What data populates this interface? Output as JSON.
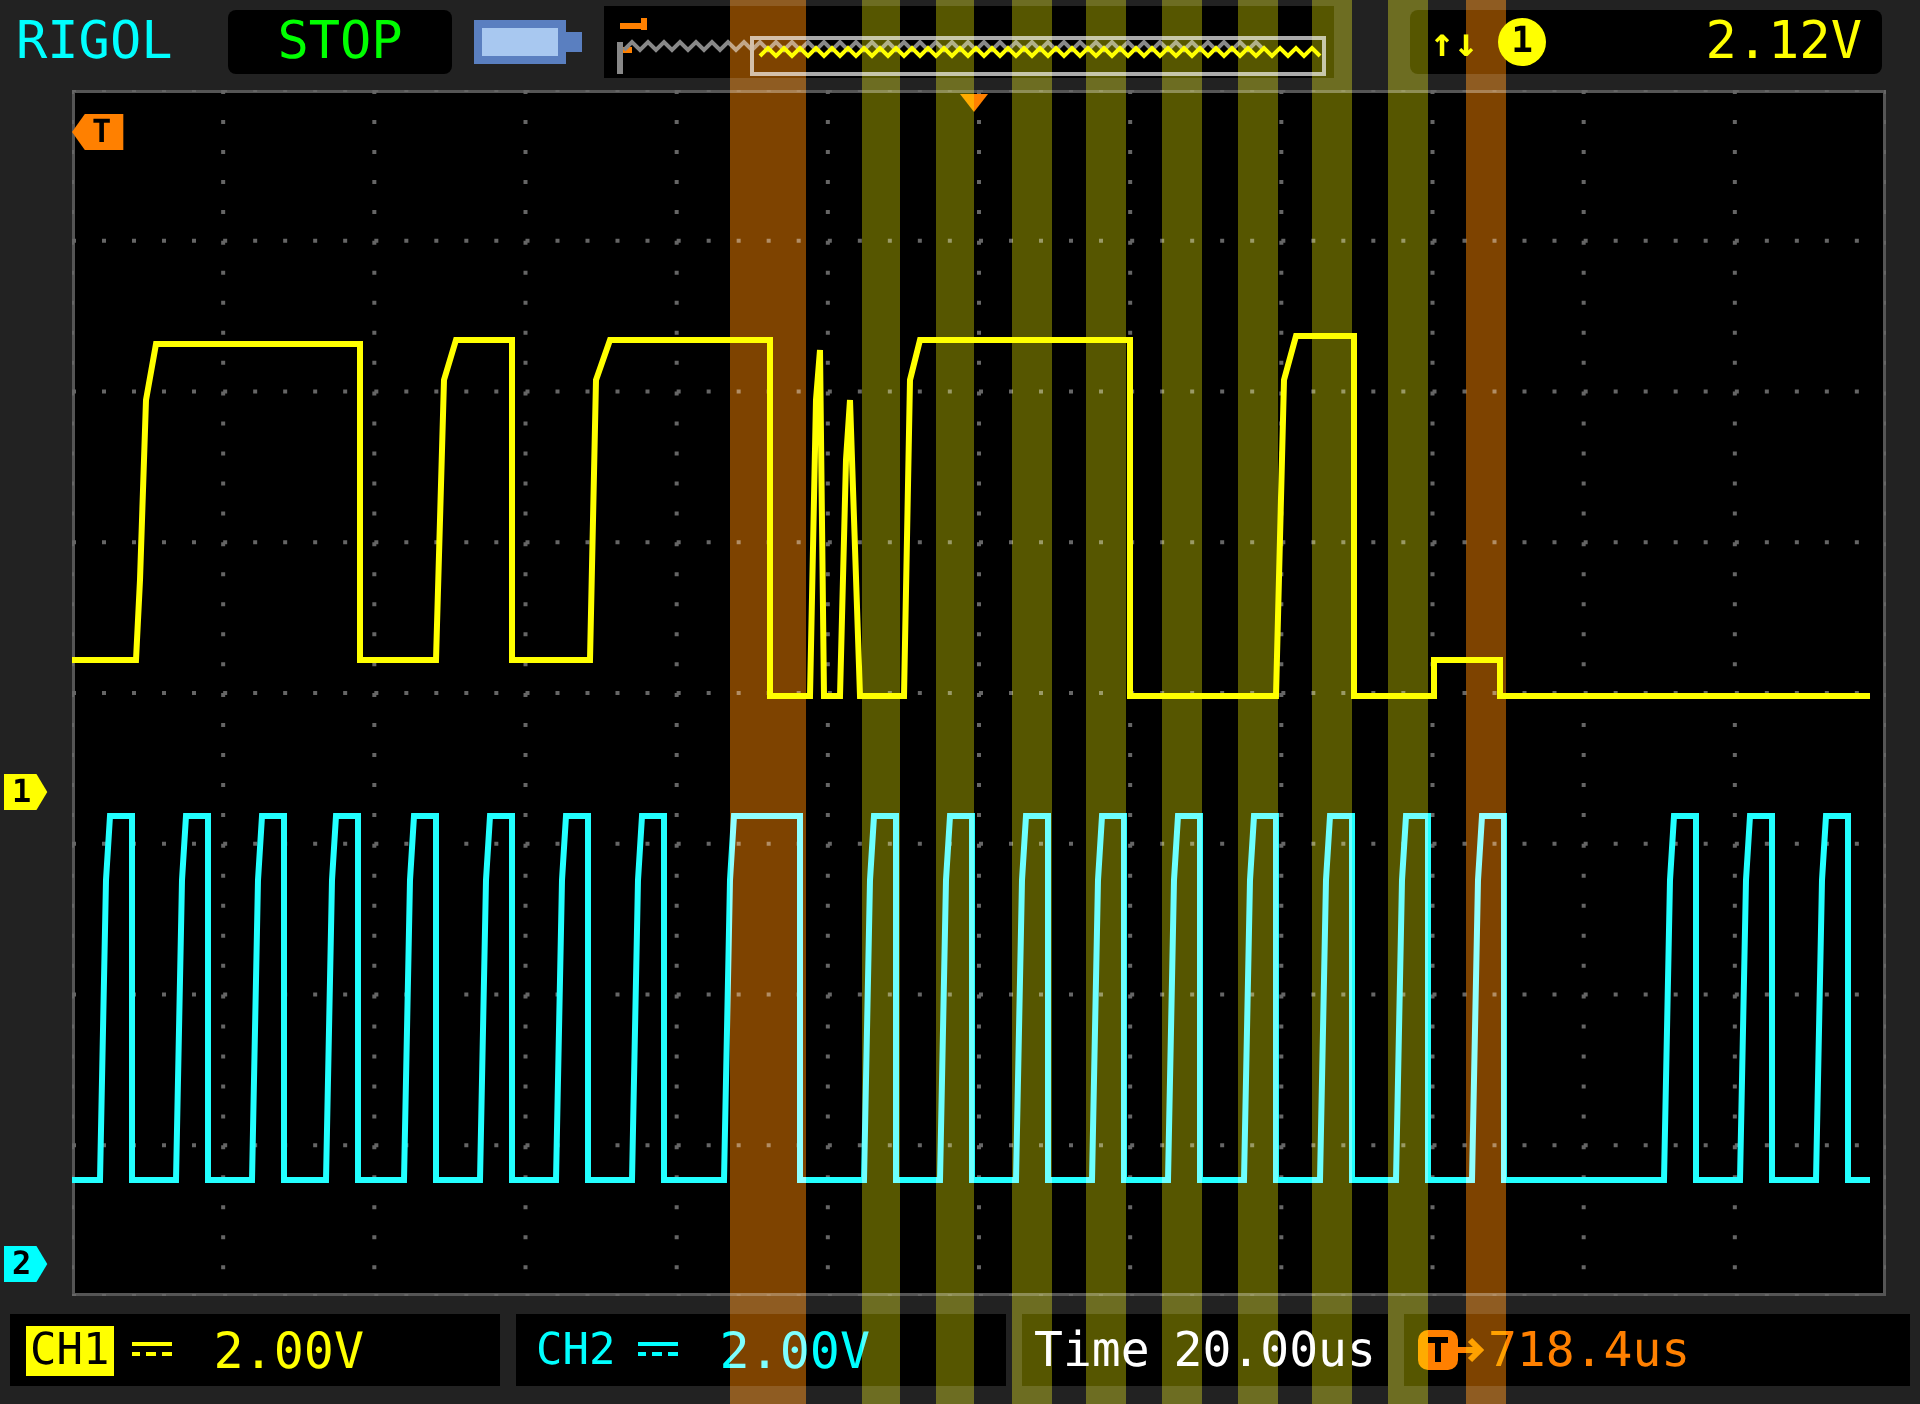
{
  "brand": "RIGOL",
  "run_state": "STOP",
  "trigger": {
    "slope": "↑↓",
    "source": "1",
    "level": "2.12V"
  },
  "markers": {
    "trigger": "T",
    "channels": [
      "1",
      "2"
    ]
  },
  "channels": [
    {
      "label": "CH1",
      "scale": "2.00V",
      "selected": true,
      "color": "#ffff00"
    },
    {
      "label": "CH2",
      "scale": "2.00V",
      "selected": false,
      "color": "#00ffff"
    }
  ],
  "timebase": {
    "label": "Time",
    "value": "20.00us"
  },
  "trigger_offset": {
    "value": "718.4us"
  }
}
